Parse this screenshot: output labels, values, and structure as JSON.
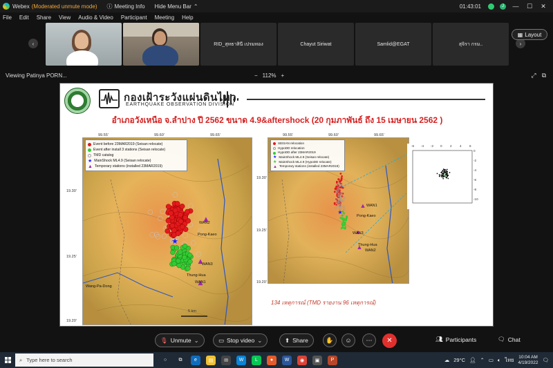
{
  "titlebar": {
    "app_name": "Webex",
    "mode": "(Moderated unmute mode)",
    "meeting_info": "Meeting Info",
    "hide_menu": "Hide Menu Bar",
    "timer": "01:43:01",
    "avatar_letter": "J"
  },
  "menu": [
    "File",
    "Edit",
    "Share",
    "View",
    "Audio & Video",
    "Participant",
    "Meeting",
    "Help"
  ],
  "participants": [
    {
      "name": ""
    },
    {
      "name": ""
    },
    {
      "name": "RID_สุทธาสินี เปรมทอง"
    },
    {
      "name": "Chayut Siriwat"
    },
    {
      "name": "Samlid@EGAT"
    },
    {
      "name": "สุจิรา กรม.."
    }
  ],
  "layout_label": "Layout",
  "viewbar": {
    "viewing": "Viewing Patinya PORN...",
    "zoom_out": "−",
    "zoom": "112%",
    "zoom_in": "+"
  },
  "slide": {
    "org_thai": "กองเฝ้าระวังแผ่นดินไหว",
    "org_en": "EARTHQUAKE OBSERVATION DIVISION",
    "title": "อำเภอวังเหนือ จ.ลำปาง ปี 2562 ขนาด 4.9&aftershock (20 กุมภาพันธ์ ถึง 15 เมษายน 2562 )",
    "left_map": {
      "top_ticks": [
        "99.55'",
        "99.60'",
        "99.65'"
      ],
      "left_ticks": [
        "19.30'",
        "19.25'",
        "19.20'"
      ],
      "legend": [
        {
          "label": "Event before 23MAR2019 (Seisan relocate)",
          "color": "#e31a1c",
          "shape": "circle"
        },
        {
          "label": "Event after install 3 stations (Seisan relocate)",
          "color": "#33cc33",
          "shape": "circle"
        },
        {
          "label": "TMD catalog",
          "color": "#bbbbbb",
          "shape": "ring"
        },
        {
          "label": "MainShock ML4.9 (Seisan relocate)",
          "color": "#1a1aff",
          "shape": "star"
        },
        {
          "label": "Temporary stations (installed 23MAR2019)",
          "color": "#9c27b0",
          "shape": "triangle"
        }
      ],
      "place_labels": [
        "Pong-Kaeo",
        "Thung-Hua",
        "WAN1",
        "WAN2",
        "WAN3",
        "Wang-Pa-Dong"
      ],
      "scale": "5 km"
    },
    "right_map": {
      "top_ticks": [
        "99.55'",
        "99.60'",
        "99.65'"
      ],
      "left_ticks": [
        "19.30'",
        "19.25'",
        "19.20'"
      ],
      "legend": [
        {
          "label": "SEISAN relocation",
          "color": "#e31a1c",
          "shape": "circle"
        },
        {
          "label": "HypoDD relocation",
          "color": "#bbbbbb",
          "shape": "ring"
        },
        {
          "label": "HypoDD after 23MAR2019",
          "color": "#33cc33",
          "shape": "circle"
        },
        {
          "label": "MainShock ML4.9 (Seisan relocate)",
          "color": "#1a1aff",
          "shape": "star"
        },
        {
          "label": "MainShock ML4.9 (HypoDD relocate)",
          "color": "#33cc33",
          "shape": "star"
        },
        {
          "label": "Temporary stations (installed 23MAR2019)",
          "color": "#9c27b0",
          "shape": "triangle"
        }
      ],
      "place_labels": [
        "WAN1",
        "WAN2",
        "WAN3",
        "Pong-Kaeo",
        "Thung-Hua"
      ]
    },
    "inset": {
      "top_ticks": [
        "-6",
        "-4",
        "-2",
        "0",
        "2",
        "4",
        "6"
      ],
      "right_ticks": [
        "0",
        "-2",
        "-4",
        "-6",
        "-8",
        "-10"
      ]
    },
    "footnote": "134 เหตุการณ์  (TMD รายงาน 96 เหตุการณ์)"
  },
  "controls": {
    "unmute": "Unmute",
    "stop_video": "Stop video",
    "share": "Share",
    "participants": "Participants",
    "chat": "Chat"
  },
  "taskbar": {
    "search_placeholder": "Type here to search",
    "weather": "29°C",
    "lang": "ไทย",
    "time": "10:04 AM",
    "date": "4/19/2022"
  }
}
